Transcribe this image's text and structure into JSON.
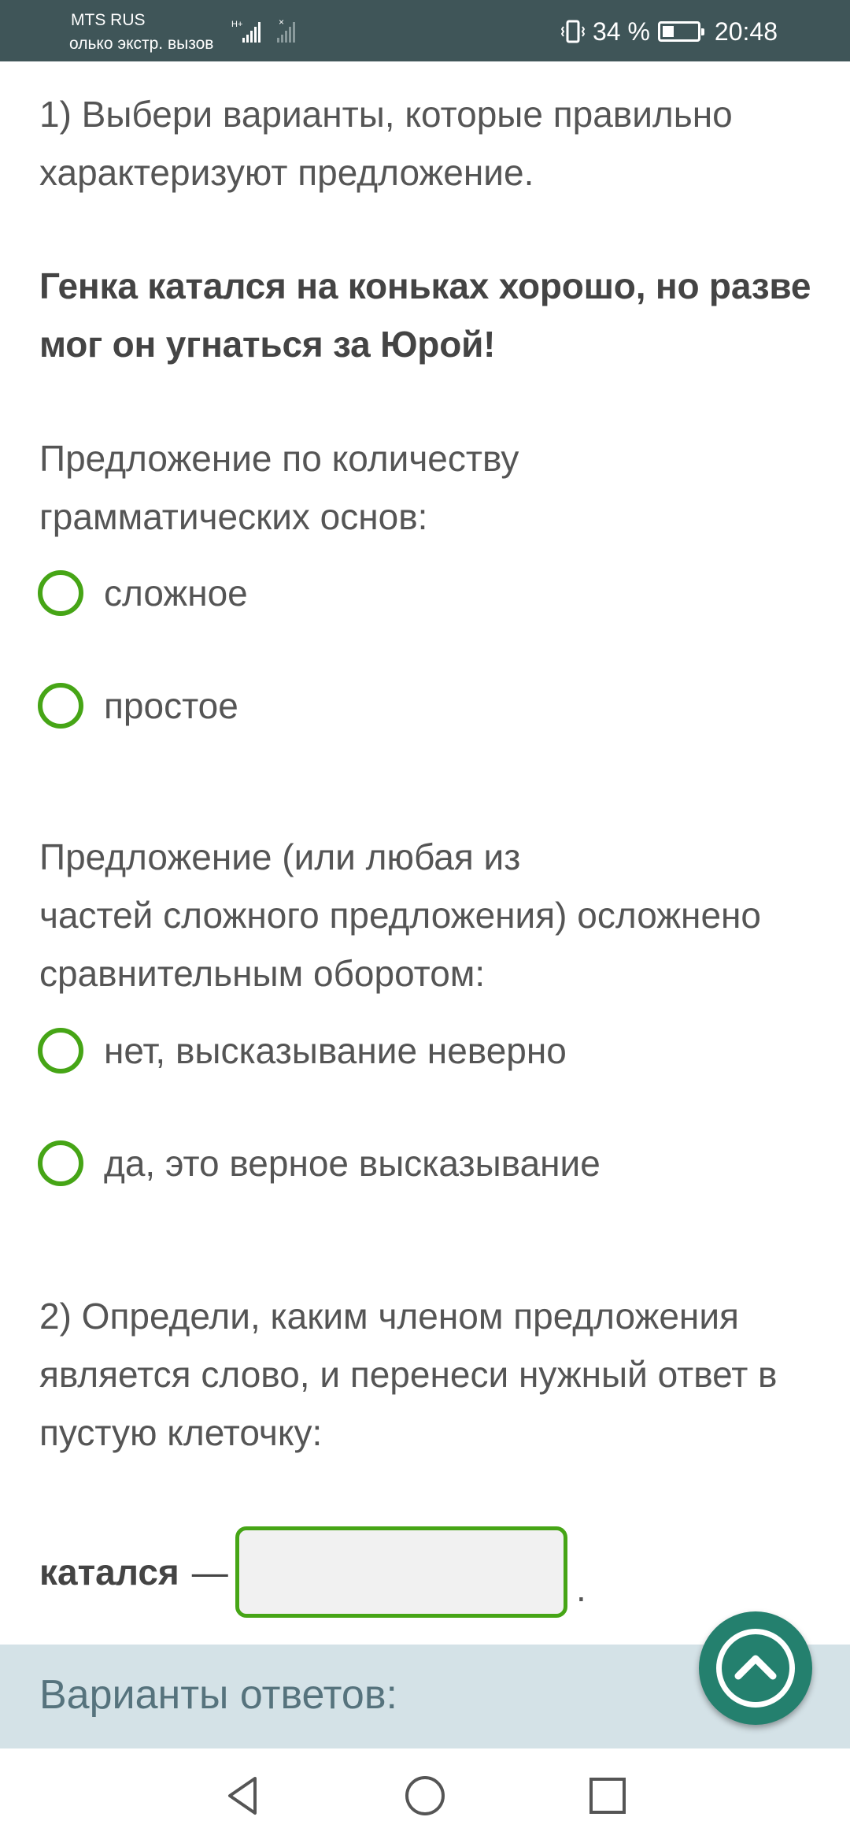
{
  "status_bar": {
    "carrier": "MTS RUS",
    "carrier_sub": "олько экстр. вызов",
    "battery": "34 %",
    "battery_level": 0.34,
    "time": "20:48"
  },
  "task1": {
    "prompt_line1": "1) Выбери варианты, которые правильно",
    "prompt_line2": "характеризуют предложение.",
    "sentence_line1": "Генка катался на коньках хорошо, но разве",
    "sentence_line2": "мог он угнаться за Юрой!",
    "group1": {
      "question_line1": "Предложение по количеству",
      "question_line2": "грамматических основ:",
      "options": [
        "сложное",
        "простое"
      ]
    },
    "group2": {
      "question_line1": "Предложение (или любая из",
      "question_line2": "частей сложного предложения) осложнено",
      "question_line3": "сравнительным оборотом:",
      "options": [
        "нет, высказывание неверно",
        "да, это верное высказывание"
      ]
    }
  },
  "task2": {
    "prompt_line1": "2) Определи, каким членом предложения",
    "prompt_line2": "является слово, и перенеси нужный ответ в",
    "prompt_line3": "пустую клеточку:",
    "word": "катался",
    "dash": "—",
    "period": "."
  },
  "variants": {
    "title": "Варианты ответов:"
  },
  "icons": {
    "fab": "chevron-up-icon",
    "nav_back": "back-triangle-icon",
    "nav_home": "home-circle-icon",
    "nav_recent": "recent-square-icon"
  },
  "colors": {
    "status_bar": "#3f5558",
    "accent_green": "#46a516",
    "fab": "#24806e",
    "variants_bar": "#d4e2e7"
  }
}
